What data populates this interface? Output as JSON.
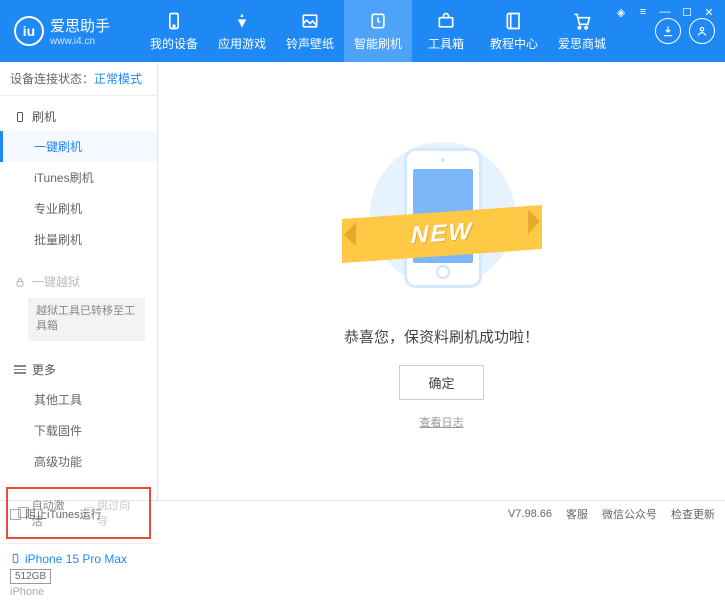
{
  "header": {
    "app_name": "爱思助手",
    "app_url": "www.i4.cn",
    "nav": [
      {
        "label": "我的设备"
      },
      {
        "label": "应用游戏"
      },
      {
        "label": "铃声壁纸"
      },
      {
        "label": "智能刷机"
      },
      {
        "label": "工具箱"
      },
      {
        "label": "教程中心"
      },
      {
        "label": "爱思商城"
      }
    ]
  },
  "status": {
    "label": "设备连接状态：",
    "mode": "正常模式"
  },
  "sidebar": {
    "flash": {
      "heading": "刷机",
      "items": [
        "一键刷机",
        "iTunes刷机",
        "专业刷机",
        "批量刷机"
      ]
    },
    "jailbreak": {
      "heading": "一键越狱",
      "note": "越狱工具已转移至工具箱"
    },
    "more": {
      "heading": "更多",
      "items": [
        "其他工具",
        "下载固件",
        "高级功能"
      ]
    },
    "checks": {
      "auto_activate": "自动激活",
      "skip_guide": "跳过向导"
    },
    "device": {
      "name": "iPhone 15 Pro Max",
      "storage": "512GB",
      "type": "iPhone"
    }
  },
  "main": {
    "ribbon": "NEW",
    "success": "恭喜您，保资料刷机成功啦！",
    "ok": "确定",
    "log": "查看日志"
  },
  "footer": {
    "block_itunes": "阻止iTunes运行",
    "version": "V7.98.66",
    "links": [
      "客服",
      "微信公众号",
      "检查更新"
    ]
  }
}
